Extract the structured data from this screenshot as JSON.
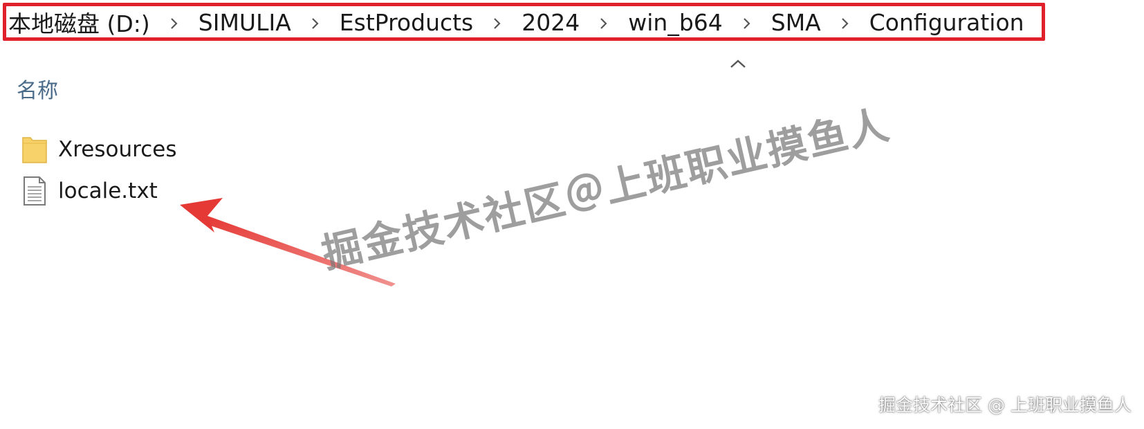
{
  "breadcrumb": {
    "items": [
      "本地磁盘 (D:)",
      "SIMULIA",
      "EstProducts",
      "2024",
      "win_b64",
      "SMA",
      "Configuration"
    ],
    "separator_icon": "chevron-right-icon",
    "highlight_color": "#e0202a"
  },
  "column_header": {
    "label": "名称",
    "sort_icon": "chevron-up-icon"
  },
  "files": [
    {
      "name": "Xresources",
      "type": "folder",
      "icon": "folder-icon"
    },
    {
      "name": "locale.txt",
      "type": "text-file",
      "icon": "text-file-icon"
    }
  ],
  "annotation": {
    "arrow_color": "#e53935",
    "arrow_icon": "arrow-annotation-icon"
  },
  "watermark": {
    "center_text": "掘金技术社区＠上班职业摸鱼人",
    "corner_text": "掘金技术社区 @ 上班职业摸鱼人"
  }
}
